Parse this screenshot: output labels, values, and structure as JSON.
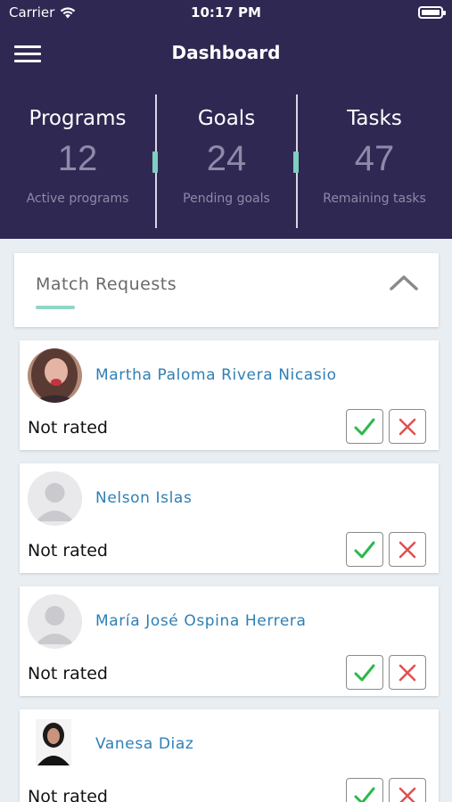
{
  "status_bar": {
    "carrier": "Carrier",
    "time": "10:17 PM"
  },
  "header": {
    "title": "Dashboard"
  },
  "stats": [
    {
      "label": "Programs",
      "value": "12",
      "sub": "Active programs"
    },
    {
      "label": "Goals",
      "value": "24",
      "sub": "Pending goals"
    },
    {
      "label": "Tasks",
      "value": "47",
      "sub": "Remaining tasks"
    }
  ],
  "section": {
    "title": "Match Requests"
  },
  "requests": [
    {
      "name": "Martha Paloma Rivera Nicasio",
      "rating": "Not rated",
      "avatar": "photo-avatar"
    },
    {
      "name": "Nelson Islas",
      "rating": "Not rated",
      "avatar": "default-avatar"
    },
    {
      "name": "María José Ospina Herrera",
      "rating": "Not rated",
      "avatar": "default-avatar"
    },
    {
      "name": "Vanesa Diaz",
      "rating": "Not rated",
      "avatar": "photo-avatar"
    }
  ],
  "colors": {
    "header_bg": "#2f2853",
    "accent": "#8fd6c6",
    "link": "#2f7fb5",
    "accept": "#2db84d",
    "reject": "#e05050"
  }
}
